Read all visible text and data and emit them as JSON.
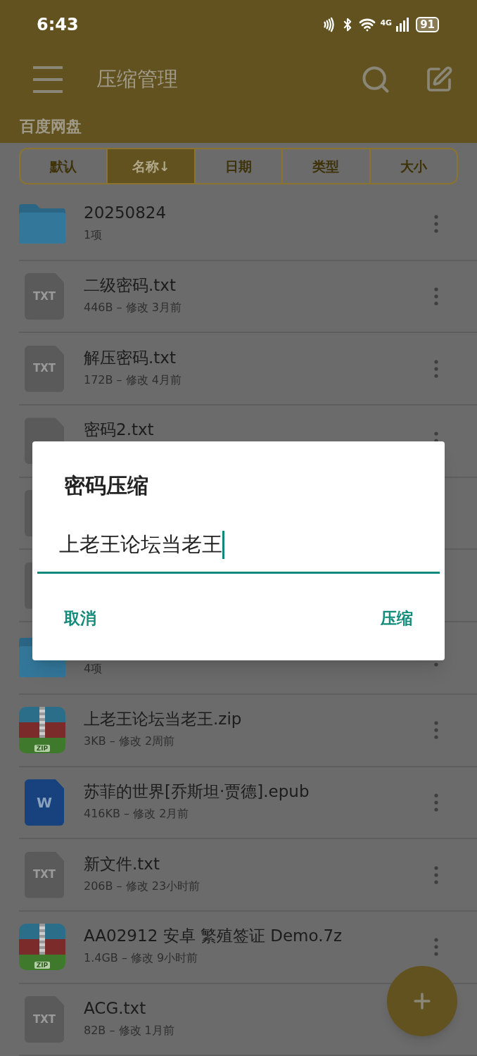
{
  "status_bar": {
    "time": "6:43",
    "network": "4G",
    "battery": "91"
  },
  "app_bar": {
    "title": "压缩管理",
    "location": "百度网盘"
  },
  "sort_tabs": [
    {
      "label": "默认",
      "selected": false
    },
    {
      "label": "名称↓",
      "selected": true
    },
    {
      "label": "日期",
      "selected": false
    },
    {
      "label": "类型",
      "selected": false
    },
    {
      "label": "大小",
      "selected": false
    }
  ],
  "files": [
    {
      "kind": "folder",
      "name": "20250824",
      "meta": "1项"
    },
    {
      "kind": "txt",
      "badge": "TXT",
      "name": "二级密码.txt",
      "meta": "446B – 修改 3月前"
    },
    {
      "kind": "txt",
      "badge": "TXT",
      "name": "解压密码.txt",
      "meta": "172B – 修改 4月前"
    },
    {
      "kind": "txt",
      "name": "密码2.txt"
    },
    {
      "kind": "txt"
    },
    {
      "kind": "txt"
    },
    {
      "kind": "folder",
      "meta": "4项"
    },
    {
      "kind": "zip",
      "badge": "ZIP",
      "name": "上老王论坛当老王.zip",
      "meta": "3KB – 修改 2周前"
    },
    {
      "kind": "word",
      "badge": "W",
      "name": "苏菲的世界[乔斯坦·贾德].epub",
      "meta": "416KB – 修改 2月前"
    },
    {
      "kind": "txt",
      "badge": "TXT",
      "name": "新文件.txt",
      "meta": "206B – 修改 23小时前"
    },
    {
      "kind": "zip",
      "badge": "ZIP",
      "name": "AA02912 安卓 繁殖签证 Demo.7z",
      "meta": "1.4GB – 修改 9小时前"
    },
    {
      "kind": "txt",
      "badge": "TXT",
      "name": "ACG.txt",
      "meta": "82B – 修改 1月前"
    }
  ],
  "dialog": {
    "title": "密码压缩",
    "value": "上老王论坛当老王",
    "buttons": [
      "取消",
      "压缩"
    ]
  }
}
